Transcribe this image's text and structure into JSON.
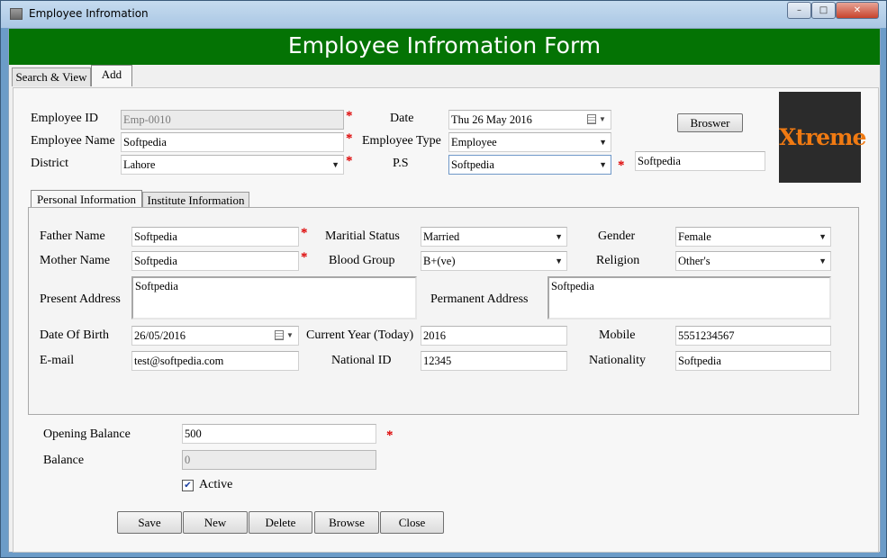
{
  "window": {
    "title": "Employee Infromation",
    "minimize": "–",
    "maximize": "□",
    "close": "✕"
  },
  "header": {
    "title": "Employee Infromation Form"
  },
  "tabs": [
    {
      "label": "Search & View"
    },
    {
      "label": "Add"
    }
  ],
  "employee": {
    "id_label": "Employee ID",
    "id_value": "Emp-0010",
    "name_label": "Employee Name",
    "name_value": "Softpedia",
    "district_label": "District",
    "district_value": "Lahore",
    "date_label": "Date",
    "date_value": "Thu 26 May 2016",
    "type_label": "Employee Type",
    "type_value": "Employee",
    "ps_label": "P.S",
    "ps_value": "Softpedia",
    "ps_text": "Softpedia",
    "browse_label": "Broswer",
    "logo_text": "Xtreme",
    "required_mark": "*"
  },
  "inner_tabs": [
    {
      "label": "Personal Information"
    },
    {
      "label": "Institute Information"
    }
  ],
  "personal": {
    "father_label": "Father Name",
    "father_value": "Softpedia",
    "mother_label": "Mother Name",
    "mother_value": "Softpedia",
    "present_label": "Present Address",
    "present_value": "Softpedia",
    "dob_label": "Date Of Birth",
    "dob_value": "26/05/2016",
    "email_label": "E-mail",
    "email_value": "test@softpedia.com",
    "marital_label": "Maritial Status",
    "marital_value": "Married",
    "blood_label": "Blood Group",
    "blood_value": "B+(ve)",
    "permanent_label": "Permanent Address",
    "permanent_value": "Softpedia",
    "year_label": "Current Year (Today)",
    "year_value": "2016",
    "nid_label": "National ID",
    "nid_value": "12345",
    "gender_label": "Gender",
    "gender_value": "Female",
    "religion_label": "Religion",
    "religion_value": "Other's",
    "mobile_label": "Mobile",
    "mobile_value": "5551234567",
    "nationality_label": "Nationality",
    "nationality_value": "Softpedia"
  },
  "balance": {
    "opening_label": "Opening Balance",
    "opening_value": "500",
    "balance_label": "Balance",
    "balance_value": "0",
    "active_label": "Active",
    "active_checked": true
  },
  "actions": [
    {
      "label": "Save"
    },
    {
      "label": "New"
    },
    {
      "label": "Delete"
    },
    {
      "label": "Browse"
    },
    {
      "label": "Close"
    }
  ],
  "colors": {
    "header_bg": "#047304",
    "required": "#dd0000",
    "logo_text": "#f07a12",
    "logo_bg": "#2b2b2b"
  }
}
